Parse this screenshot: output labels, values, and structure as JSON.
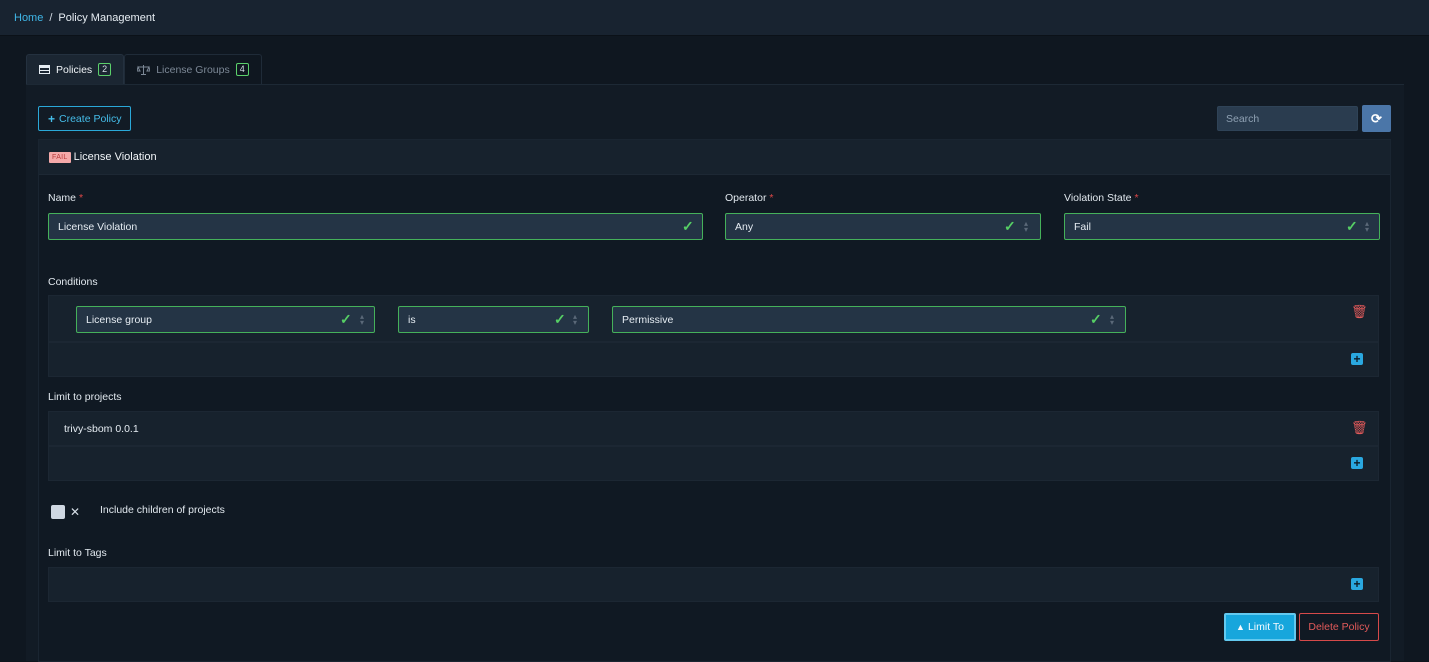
{
  "breadcrumb": {
    "home": "Home",
    "separator": "/",
    "current": "Policy Management"
  },
  "tabs": [
    {
      "icon": "table-icon",
      "label": "Policies",
      "count": "2",
      "active": true
    },
    {
      "icon": "scale-icon",
      "label": "License Groups",
      "count": "4",
      "active": false
    }
  ],
  "toolbar": {
    "create_label": "Create Policy",
    "search_placeholder": "Search",
    "refresh_icon": "refresh-icon"
  },
  "policy": {
    "badge": "FAIL",
    "title": "License Violation",
    "name_label": "Name",
    "name_value": "License Violation",
    "operator_label": "Operator",
    "operator_value": "Any",
    "violation_label": "Violation State",
    "violation_value": "Fail",
    "required_mark": "*",
    "conditions_label": "Conditions",
    "condition": {
      "subject": "License group",
      "operator": "is",
      "value": "Permissive"
    },
    "limit_projects_label": "Limit to projects",
    "project": "trivy-sbom 0.0.1",
    "include_children_label": "Include children of projects",
    "include_children_mark": "✕",
    "limit_tags_label": "Limit to Tags",
    "limit_to_button": "Limit To",
    "delete_button": "Delete Policy"
  },
  "colors": {
    "accent": "#2aa8e0",
    "success": "#56cf65",
    "danger": "#e25a5a",
    "background": "#0f1720"
  }
}
